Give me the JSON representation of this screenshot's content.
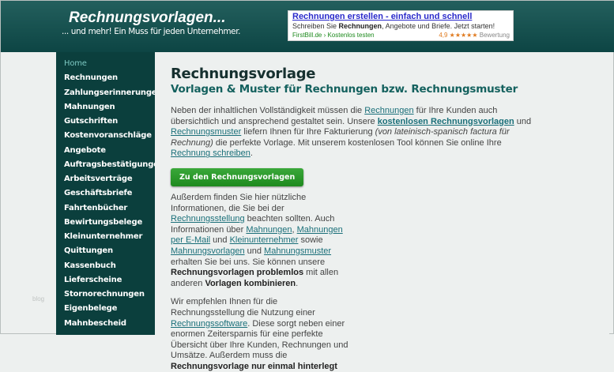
{
  "header": {
    "title": "Rechnungsvorlagen...",
    "subtitle": "... und mehr! Ein Muss für jeden Unternehmer."
  },
  "ad": {
    "title": "Rechnungen erstellen - einfach und schnell",
    "desc_pre": "Schreiben Sie ",
    "desc_bold": "Rechnungen",
    "desc_post": ", Angebote und Briefe. Jetzt starten!",
    "url": "FirstBill.de › Kostenlos testen",
    "rating": "4,9 ★★★★★",
    "rating_label": "Bewertung"
  },
  "sidebar": {
    "items": [
      "Home",
      "Rechnungen",
      "Zahlungserinnerungen",
      "Mahnungen",
      "Gutschriften",
      "Kostenvoranschläge",
      "Angebote",
      "Auftragsbestätigungen",
      "Arbeitsverträge",
      "Geschäftsbriefe",
      "Fahrtenbücher",
      "Bewirtungsbelege",
      "Kleinunternehmer",
      "Quittungen",
      "Kassenbuch",
      "Lieferscheine",
      "Stornorechnungen",
      "Eigenbelege",
      "Mahnbescheid"
    ]
  },
  "blog": "blog",
  "main": {
    "title": "Rechnungsvorlage",
    "subtitle": "Vorlagen & Muster für Rechnungen bzw. Rechnungsmuster",
    "p1": [
      "Neben der inhaltlichen Vollständigkeit müssen die ",
      "Rechnungen",
      " für Ihre Kunden auch übersichtlich und ansprechend gestaltet sein. Unsere ",
      "kostenlosen Rechnungsvorlagen",
      " und ",
      "Rechnungsmuster",
      " liefern Ihnen für Ihre Fakturierung ",
      "(von lateinisch-spanisch factura für Rechnung)",
      " die perfekte Vorlage. Mit unserem kostenlosen Tool können Sie online Ihre ",
      "Rechnung schreiben",
      "."
    ],
    "button": "Zu den Rechnungsvorlagen",
    "p2": [
      "Außerdem finden Sie hier nützliche Informationen, die Sie bei der ",
      "Rechnungsstellung",
      " beachten sollten. Auch Informationen über ",
      "Mahnungen",
      ", ",
      "Mahnungen per E-Mail",
      " und ",
      "Kleinunternehmer",
      " sowie ",
      "Mahnungsvorlagen",
      " und ",
      "Mahnungsmuster",
      " erhalten Sie bei uns. Sie können unsere ",
      "Rechnungsvorlagen problemlos",
      " mit allen anderen ",
      "Vorlagen kombinieren",
      "."
    ],
    "p3": [
      "Wir empfehlen Ihnen für die Rechnungsstellung die Nutzung einer ",
      "Rechnungssoftware",
      ". Diese sorgt neben einer enormen Zeitersparnis für eine perfekte Übersicht über Ihre Kunden, Rechnungen und Umsätze. Außerdem muss die ",
      "Rechnungsvorlage nur einmal hinterlegt"
    ]
  }
}
